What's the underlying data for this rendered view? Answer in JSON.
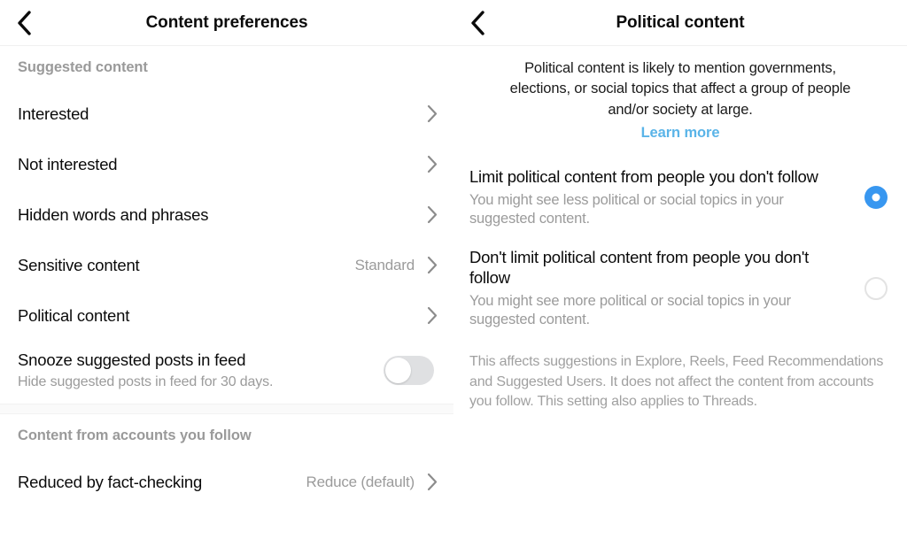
{
  "left_panel": {
    "header": {
      "back_icon": "chevron-left-icon",
      "title": "Content preferences"
    },
    "sections": [
      {
        "label": "Suggested content",
        "rows": [
          {
            "label": "Interested",
            "value": "",
            "chevron": "chevron-right-icon"
          },
          {
            "label": "Not interested",
            "value": "",
            "chevron": "chevron-right-icon"
          },
          {
            "label": "Hidden words and phrases",
            "value": "",
            "chevron": "chevron-right-icon"
          },
          {
            "label": "Sensitive content",
            "value": "Standard",
            "chevron": "chevron-right-icon"
          },
          {
            "label": "Political content",
            "value": "",
            "chevron": "chevron-right-icon"
          }
        ],
        "toggle_row": {
          "title": "Snooze suggested posts in feed",
          "subtitle": "Hide suggested posts in feed for 30 days.",
          "state": "off"
        }
      },
      {
        "label": "Content from accounts you follow",
        "rows": [
          {
            "label": "Reduced by fact-checking",
            "value": "Reduce (default)",
            "chevron": "chevron-right-icon"
          }
        ]
      }
    ]
  },
  "right_panel": {
    "header": {
      "back_icon": "chevron-left-icon",
      "title": "Political content"
    },
    "intro": {
      "text": "Political content is likely to mention governments, elections, or social topics that affect a group of people and/or society at large.",
      "link_label": "Learn more"
    },
    "options": [
      {
        "title": "Limit political content from people you don't follow",
        "subtitle": "You might see less political or social topics in your suggested content.",
        "selected": true
      },
      {
        "title": "Don't limit political content from people you don't follow",
        "subtitle": "You might see more political or social topics in your suggested content.",
        "selected": false
      }
    ],
    "footnote": "This affects suggestions in Explore, Reels, Feed Recommendations and Suggested Users. It does not affect the content from accounts you follow. This setting also applies to Threads."
  },
  "colors": {
    "accent_blue": "#3897f0",
    "link_blue": "#5ab4e8",
    "primary_text": "#0b0b0b",
    "secondary_text": "#9b9b9b",
    "toggle_off_track": "#dfe0e2",
    "divider": "#f0f0f0"
  }
}
